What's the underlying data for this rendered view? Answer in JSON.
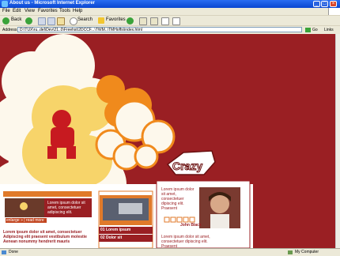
{
  "window": {
    "title": "About us - Microsoft Internet Explorer"
  },
  "menu": [
    "File",
    "Edit",
    "View",
    "Favorites",
    "Tools",
    "Help"
  ],
  "toolbar": {
    "back": "Back",
    "search": "Search",
    "favorites": "Favorites"
  },
  "address": {
    "label": "Address",
    "value": "D:\\TUX\\ru..del\\Dev\\21..0\\Freehst\\2DCCF...\\TWM..\\TMHoffs\\index.html",
    "go": "Go",
    "links": "Links"
  },
  "page": {
    "logo_text": "Crazy",
    "left_box": {
      "text": "Lorem ipsum dolor sit amet, consectetuer adipiscing elit.",
      "button_label": "enlarge » | read more"
    },
    "links": [
      "Lorem ipsum dolor sit amet, consectetuer",
      "Adipiscing elit praesent vestibulum molestie",
      "Aenean nonummy hendrerit mauris"
    ],
    "numbered": [
      {
        "num": "01",
        "label": "Lorem ipsum"
      },
      {
        "num": "02",
        "label": "Dolor sit"
      }
    ],
    "profile": {
      "top_text": "Lorem ipsum dolor sit amet, consectetuer dipiscing elit. Praesent",
      "name": "John Black",
      "bottom_text": "Lorem ipsum dolor sit amet, consectetuer dipiscing elit. Praesent"
    }
  },
  "status": {
    "text": "Done",
    "zone": "My Computer"
  },
  "colors": {
    "page_bg": "#9a1f23",
    "cloud_white": "#fdf8ec",
    "cloud_yellow": "#f7d46a",
    "cloud_orange": "#f08a1c",
    "accent": "#e07a2a"
  }
}
